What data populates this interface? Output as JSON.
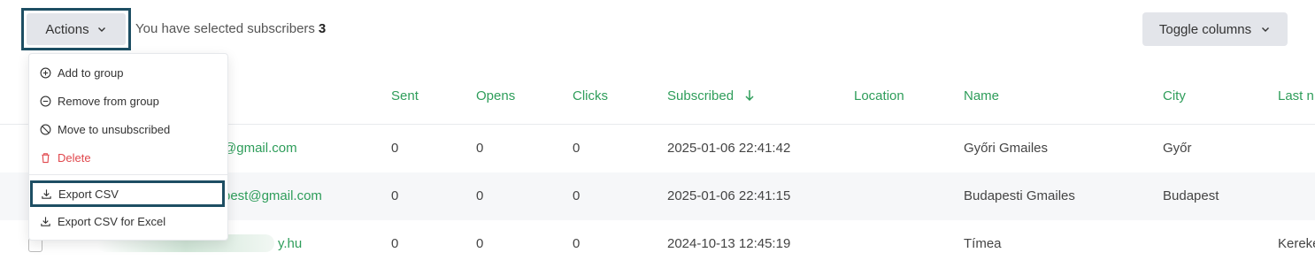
{
  "toolbar": {
    "actions_label": "Actions",
    "selected_text": "You have selected subscribers",
    "selected_count": "3",
    "toggle_columns_label": "Toggle columns"
  },
  "actions_menu": {
    "items": [
      {
        "label": "Add to group",
        "icon": "plus-circle-icon"
      },
      {
        "label": "Remove from group",
        "icon": "minus-circle-icon"
      },
      {
        "label": "Move to unsubscribed",
        "icon": "ban-icon"
      },
      {
        "label": "Delete",
        "icon": "trash-icon"
      },
      {
        "label": "Export CSV",
        "icon": "download-icon"
      },
      {
        "label": "Export CSV for Excel",
        "icon": "download-icon"
      }
    ]
  },
  "table": {
    "columns": [
      "Sent",
      "Opens",
      "Clicks",
      "Subscribed",
      "Location",
      "Name",
      "City",
      "Last n"
    ],
    "sort_column": "Subscribed",
    "sort_direction": "descending",
    "rows": [
      {
        "email": "@gmail.com",
        "sent": "0",
        "opens": "0",
        "clicks": "0",
        "subscribed": "2025-01-06 22:41:42",
        "location": "",
        "name": "Győri Gmailes",
        "city": "Győr",
        "last_name": ""
      },
      {
        "email": "pest@gmail.com",
        "sent": "0",
        "opens": "0",
        "clicks": "0",
        "subscribed": "2025-01-06 22:41:15",
        "location": "",
        "name": "Budapesti Gmailes",
        "city": "Budapest",
        "last_name": ""
      },
      {
        "email": "y.hu",
        "sent": "0",
        "opens": "0",
        "clicks": "0",
        "subscribed": "2024-10-13 12:45:19",
        "location": "",
        "name": "Tímea",
        "city": "",
        "last_name": "Kereke"
      }
    ]
  },
  "colors": {
    "accent_green": "#2e9d5a",
    "highlight_border": "#1d4e63",
    "danger": "#e0474c",
    "button_bg": "#e3e5ea"
  }
}
